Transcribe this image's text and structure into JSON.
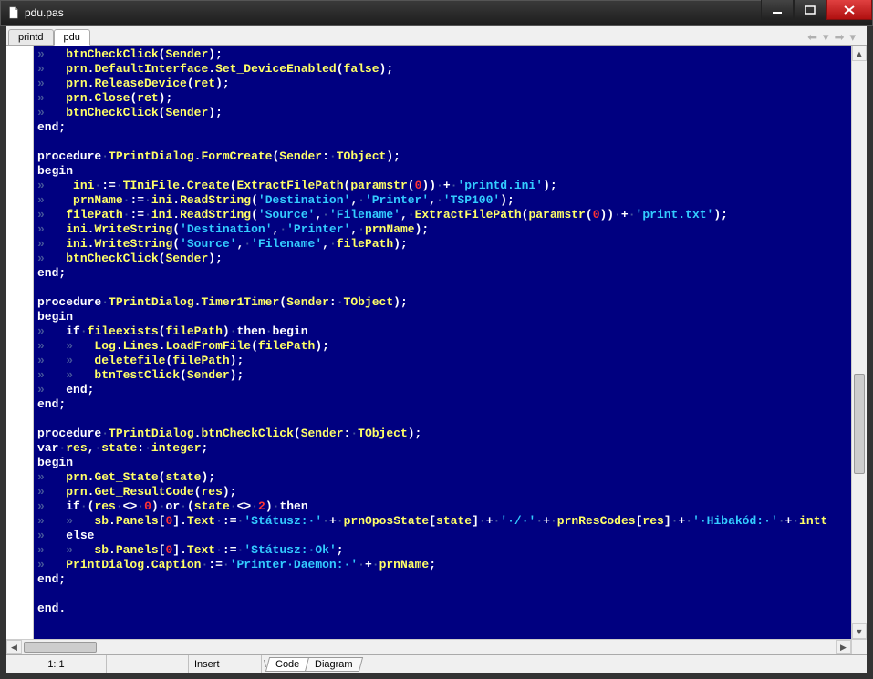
{
  "window": {
    "title": "pdu.pas"
  },
  "tabs": [
    {
      "label": "printd",
      "active": false
    },
    {
      "label": "pdu",
      "active": true
    }
  ],
  "status": {
    "position": "1: 1",
    "modified": "",
    "insert_mode": "Insert",
    "sheet_tabs": [
      "Code",
      "Diagram"
    ],
    "active_sheet": 0
  },
  "colors": {
    "editor_bg": "#000080",
    "keyword": "#ffffff",
    "identifier": "#ffff66",
    "string": "#33ccff",
    "number": "#ff3333",
    "whitespace": "#445599"
  },
  "code_lines": [
    [
      [
        "ws",
        "»   "
      ],
      [
        "id",
        "btnCheckClick"
      ],
      [
        "sym",
        "("
      ],
      [
        "id",
        "Sender"
      ],
      [
        "sym",
        ");"
      ]
    ],
    [
      [
        "ws",
        "»   "
      ],
      [
        "id",
        "prn"
      ],
      [
        "sym",
        "."
      ],
      [
        "id",
        "DefaultInterface"
      ],
      [
        "sym",
        "."
      ],
      [
        "id",
        "Set_DeviceEnabled"
      ],
      [
        "sym",
        "("
      ],
      [
        "id",
        "false"
      ],
      [
        "sym",
        ");"
      ]
    ],
    [
      [
        "ws",
        "»   "
      ],
      [
        "id",
        "prn"
      ],
      [
        "sym",
        "."
      ],
      [
        "id",
        "ReleaseDevice"
      ],
      [
        "sym",
        "("
      ],
      [
        "id",
        "ret"
      ],
      [
        "sym",
        ");"
      ]
    ],
    [
      [
        "ws",
        "»   "
      ],
      [
        "id",
        "prn"
      ],
      [
        "sym",
        "."
      ],
      [
        "id",
        "Close"
      ],
      [
        "sym",
        "("
      ],
      [
        "id",
        "ret"
      ],
      [
        "sym",
        ");"
      ]
    ],
    [
      [
        "ws",
        "»   "
      ],
      [
        "id",
        "btnCheckClick"
      ],
      [
        "sym",
        "("
      ],
      [
        "id",
        "Sender"
      ],
      [
        "sym",
        ");"
      ]
    ],
    [
      [
        "kw",
        "end"
      ],
      [
        "sym",
        ";"
      ]
    ],
    [
      [
        "sp",
        " "
      ]
    ],
    [
      [
        "kw",
        "procedure"
      ],
      [
        "ws",
        "·"
      ],
      [
        "id",
        "TPrintDialog"
      ],
      [
        "sym",
        "."
      ],
      [
        "id",
        "FormCreate"
      ],
      [
        "sym",
        "("
      ],
      [
        "id",
        "Sender"
      ],
      [
        "sym",
        ":"
      ],
      [
        "ws",
        "·"
      ],
      [
        "id",
        "TObject"
      ],
      [
        "sym",
        ");"
      ]
    ],
    [
      [
        "kw",
        "begin"
      ]
    ],
    [
      [
        "ws",
        "»    "
      ],
      [
        "id",
        "ini"
      ],
      [
        "ws",
        "·"
      ],
      [
        "sym",
        ":="
      ],
      [
        "ws",
        "·"
      ],
      [
        "id",
        "TIniFile"
      ],
      [
        "sym",
        "."
      ],
      [
        "id",
        "Create"
      ],
      [
        "sym",
        "("
      ],
      [
        "id",
        "ExtractFilePath"
      ],
      [
        "sym",
        "("
      ],
      [
        "id",
        "paramstr"
      ],
      [
        "sym",
        "("
      ],
      [
        "num",
        "0"
      ],
      [
        "sym",
        "))"
      ],
      [
        "ws",
        "·"
      ],
      [
        "sym",
        "+"
      ],
      [
        "ws",
        "·"
      ],
      [
        "str",
        "'printd.ini'"
      ],
      [
        "sym",
        ");"
      ]
    ],
    [
      [
        "ws",
        "»    "
      ],
      [
        "id",
        "prnName"
      ],
      [
        "ws",
        "·"
      ],
      [
        "sym",
        ":="
      ],
      [
        "ws",
        "·"
      ],
      [
        "id",
        "ini"
      ],
      [
        "sym",
        "."
      ],
      [
        "id",
        "ReadString"
      ],
      [
        "sym",
        "("
      ],
      [
        "str",
        "'Destination'"
      ],
      [
        "sym",
        ","
      ],
      [
        "ws",
        "·"
      ],
      [
        "str",
        "'Printer'"
      ],
      [
        "sym",
        ","
      ],
      [
        "ws",
        "·"
      ],
      [
        "str",
        "'TSP100'"
      ],
      [
        "sym",
        ");"
      ]
    ],
    [
      [
        "ws",
        "»   "
      ],
      [
        "id",
        "filePath"
      ],
      [
        "ws",
        "·"
      ],
      [
        "sym",
        ":="
      ],
      [
        "ws",
        "·"
      ],
      [
        "id",
        "ini"
      ],
      [
        "sym",
        "."
      ],
      [
        "id",
        "ReadString"
      ],
      [
        "sym",
        "("
      ],
      [
        "str",
        "'Source'"
      ],
      [
        "sym",
        ","
      ],
      [
        "ws",
        "·"
      ],
      [
        "str",
        "'Filename'"
      ],
      [
        "sym",
        ","
      ],
      [
        "ws",
        "·"
      ],
      [
        "id",
        "ExtractFilePath"
      ],
      [
        "sym",
        "("
      ],
      [
        "id",
        "paramstr"
      ],
      [
        "sym",
        "("
      ],
      [
        "num",
        "0"
      ],
      [
        "sym",
        "))"
      ],
      [
        "ws",
        "·"
      ],
      [
        "sym",
        "+"
      ],
      [
        "ws",
        "·"
      ],
      [
        "str",
        "'print.txt'"
      ],
      [
        "sym",
        ");"
      ]
    ],
    [
      [
        "ws",
        "»   "
      ],
      [
        "id",
        "ini"
      ],
      [
        "sym",
        "."
      ],
      [
        "id",
        "WriteString"
      ],
      [
        "sym",
        "("
      ],
      [
        "str",
        "'Destination'"
      ],
      [
        "sym",
        ","
      ],
      [
        "ws",
        "·"
      ],
      [
        "str",
        "'Printer'"
      ],
      [
        "sym",
        ","
      ],
      [
        "ws",
        "·"
      ],
      [
        "id",
        "prnName"
      ],
      [
        "sym",
        ");"
      ]
    ],
    [
      [
        "ws",
        "»   "
      ],
      [
        "id",
        "ini"
      ],
      [
        "sym",
        "."
      ],
      [
        "id",
        "WriteString"
      ],
      [
        "sym",
        "("
      ],
      [
        "str",
        "'Source'"
      ],
      [
        "sym",
        ","
      ],
      [
        "ws",
        "·"
      ],
      [
        "str",
        "'Filename'"
      ],
      [
        "sym",
        ","
      ],
      [
        "ws",
        "·"
      ],
      [
        "id",
        "filePath"
      ],
      [
        "sym",
        ");"
      ]
    ],
    [
      [
        "ws",
        "»   "
      ],
      [
        "id",
        "btnCheckClick"
      ],
      [
        "sym",
        "("
      ],
      [
        "id",
        "Sender"
      ],
      [
        "sym",
        ");"
      ]
    ],
    [
      [
        "kw",
        "end"
      ],
      [
        "sym",
        ";"
      ]
    ],
    [
      [
        "sp",
        " "
      ]
    ],
    [
      [
        "kw",
        "procedure"
      ],
      [
        "ws",
        "·"
      ],
      [
        "id",
        "TPrintDialog"
      ],
      [
        "sym",
        "."
      ],
      [
        "id",
        "Timer1Timer"
      ],
      [
        "sym",
        "("
      ],
      [
        "id",
        "Sender"
      ],
      [
        "sym",
        ":"
      ],
      [
        "ws",
        "·"
      ],
      [
        "id",
        "TObject"
      ],
      [
        "sym",
        ");"
      ]
    ],
    [
      [
        "kw",
        "begin"
      ]
    ],
    [
      [
        "ws",
        "»   "
      ],
      [
        "kw",
        "if"
      ],
      [
        "ws",
        "·"
      ],
      [
        "id",
        "fileexists"
      ],
      [
        "sym",
        "("
      ],
      [
        "id",
        "filePath"
      ],
      [
        "sym",
        ")"
      ],
      [
        "ws",
        "·"
      ],
      [
        "kw",
        "then"
      ],
      [
        "ws",
        "·"
      ],
      [
        "kw",
        "begin"
      ]
    ],
    [
      [
        "ws",
        "»   »   "
      ],
      [
        "id",
        "Log"
      ],
      [
        "sym",
        "."
      ],
      [
        "id",
        "Lines"
      ],
      [
        "sym",
        "."
      ],
      [
        "id",
        "LoadFromFile"
      ],
      [
        "sym",
        "("
      ],
      [
        "id",
        "filePath"
      ],
      [
        "sym",
        ");"
      ]
    ],
    [
      [
        "ws",
        "»   »   "
      ],
      [
        "id",
        "deletefile"
      ],
      [
        "sym",
        "("
      ],
      [
        "id",
        "filePath"
      ],
      [
        "sym",
        ");"
      ]
    ],
    [
      [
        "ws",
        "»   »   "
      ],
      [
        "id",
        "btnTestClick"
      ],
      [
        "sym",
        "("
      ],
      [
        "id",
        "Sender"
      ],
      [
        "sym",
        ");"
      ]
    ],
    [
      [
        "ws",
        "»   "
      ],
      [
        "kw",
        "end"
      ],
      [
        "sym",
        ";"
      ]
    ],
    [
      [
        "kw",
        "end"
      ],
      [
        "sym",
        ";"
      ]
    ],
    [
      [
        "sp",
        " "
      ]
    ],
    [
      [
        "kw",
        "procedure"
      ],
      [
        "ws",
        "·"
      ],
      [
        "id",
        "TPrintDialog"
      ],
      [
        "sym",
        "."
      ],
      [
        "id",
        "btnCheckClick"
      ],
      [
        "sym",
        "("
      ],
      [
        "id",
        "Sender"
      ],
      [
        "sym",
        ":"
      ],
      [
        "ws",
        "·"
      ],
      [
        "id",
        "TObject"
      ],
      [
        "sym",
        ");"
      ]
    ],
    [
      [
        "kw",
        "var"
      ],
      [
        "ws",
        "·"
      ],
      [
        "id",
        "res"
      ],
      [
        "sym",
        ","
      ],
      [
        "ws",
        "·"
      ],
      [
        "id",
        "state"
      ],
      [
        "sym",
        ":"
      ],
      [
        "ws",
        "·"
      ],
      [
        "id",
        "integer"
      ],
      [
        "sym",
        ";"
      ]
    ],
    [
      [
        "kw",
        "begin"
      ]
    ],
    [
      [
        "ws",
        "»   "
      ],
      [
        "id",
        "prn"
      ],
      [
        "sym",
        "."
      ],
      [
        "id",
        "Get_State"
      ],
      [
        "sym",
        "("
      ],
      [
        "id",
        "state"
      ],
      [
        "sym",
        ");"
      ]
    ],
    [
      [
        "ws",
        "»   "
      ],
      [
        "id",
        "prn"
      ],
      [
        "sym",
        "."
      ],
      [
        "id",
        "Get_ResultCode"
      ],
      [
        "sym",
        "("
      ],
      [
        "id",
        "res"
      ],
      [
        "sym",
        ");"
      ]
    ],
    [
      [
        "ws",
        "»   "
      ],
      [
        "kw",
        "if"
      ],
      [
        "ws",
        "·"
      ],
      [
        "sym",
        "("
      ],
      [
        "id",
        "res"
      ],
      [
        "ws",
        "·"
      ],
      [
        "sym",
        "<>"
      ],
      [
        "ws",
        "·"
      ],
      [
        "num",
        "0"
      ],
      [
        "sym",
        ")"
      ],
      [
        "ws",
        "·"
      ],
      [
        "kw",
        "or"
      ],
      [
        "ws",
        "·"
      ],
      [
        "sym",
        "("
      ],
      [
        "id",
        "state"
      ],
      [
        "ws",
        "·"
      ],
      [
        "sym",
        "<>"
      ],
      [
        "ws",
        "·"
      ],
      [
        "num",
        "2"
      ],
      [
        "sym",
        ")"
      ],
      [
        "ws",
        "·"
      ],
      [
        "kw",
        "then"
      ]
    ],
    [
      [
        "ws",
        "»   »   "
      ],
      [
        "id",
        "sb"
      ],
      [
        "sym",
        "."
      ],
      [
        "id",
        "Panels"
      ],
      [
        "sym",
        "["
      ],
      [
        "num",
        "0"
      ],
      [
        "sym",
        "]."
      ],
      [
        "id",
        "Text"
      ],
      [
        "ws",
        "·"
      ],
      [
        "sym",
        ":="
      ],
      [
        "ws",
        "·"
      ],
      [
        "str",
        "'Státusz:·'"
      ],
      [
        "ws",
        "·"
      ],
      [
        "sym",
        "+"
      ],
      [
        "ws",
        "·"
      ],
      [
        "id",
        "prnOposState"
      ],
      [
        "sym",
        "["
      ],
      [
        "id",
        "state"
      ],
      [
        "sym",
        "]"
      ],
      [
        "ws",
        "·"
      ],
      [
        "sym",
        "+"
      ],
      [
        "ws",
        "·"
      ],
      [
        "str",
        "'·/·'"
      ],
      [
        "ws",
        "·"
      ],
      [
        "sym",
        "+"
      ],
      [
        "ws",
        "·"
      ],
      [
        "id",
        "prnResCodes"
      ],
      [
        "sym",
        "["
      ],
      [
        "id",
        "res"
      ],
      [
        "sym",
        "]"
      ],
      [
        "ws",
        "·"
      ],
      [
        "sym",
        "+"
      ],
      [
        "ws",
        "·"
      ],
      [
        "str",
        "'·Hibakód:·'"
      ],
      [
        "ws",
        "·"
      ],
      [
        "sym",
        "+"
      ],
      [
        "ws",
        "·"
      ],
      [
        "id",
        "intt"
      ]
    ],
    [
      [
        "ws",
        "»   "
      ],
      [
        "kw",
        "else"
      ]
    ],
    [
      [
        "ws",
        "»   »   "
      ],
      [
        "id",
        "sb"
      ],
      [
        "sym",
        "."
      ],
      [
        "id",
        "Panels"
      ],
      [
        "sym",
        "["
      ],
      [
        "num",
        "0"
      ],
      [
        "sym",
        "]."
      ],
      [
        "id",
        "Text"
      ],
      [
        "ws",
        "·"
      ],
      [
        "sym",
        ":="
      ],
      [
        "ws",
        "·"
      ],
      [
        "str",
        "'Státusz:·Ok'"
      ],
      [
        "sym",
        ";"
      ]
    ],
    [
      [
        "ws",
        "»   "
      ],
      [
        "id",
        "PrintDialog"
      ],
      [
        "sym",
        "."
      ],
      [
        "id",
        "Caption"
      ],
      [
        "ws",
        "·"
      ],
      [
        "sym",
        ":="
      ],
      [
        "ws",
        "·"
      ],
      [
        "str",
        "'Printer·Daemon:·'"
      ],
      [
        "ws",
        "·"
      ],
      [
        "sym",
        "+"
      ],
      [
        "ws",
        "·"
      ],
      [
        "id",
        "prnName"
      ],
      [
        "sym",
        ";"
      ]
    ],
    [
      [
        "kw",
        "end"
      ],
      [
        "sym",
        ";"
      ]
    ],
    [
      [
        "sp",
        " "
      ]
    ],
    [
      [
        "kw",
        "end"
      ],
      [
        "sym",
        "."
      ]
    ]
  ]
}
